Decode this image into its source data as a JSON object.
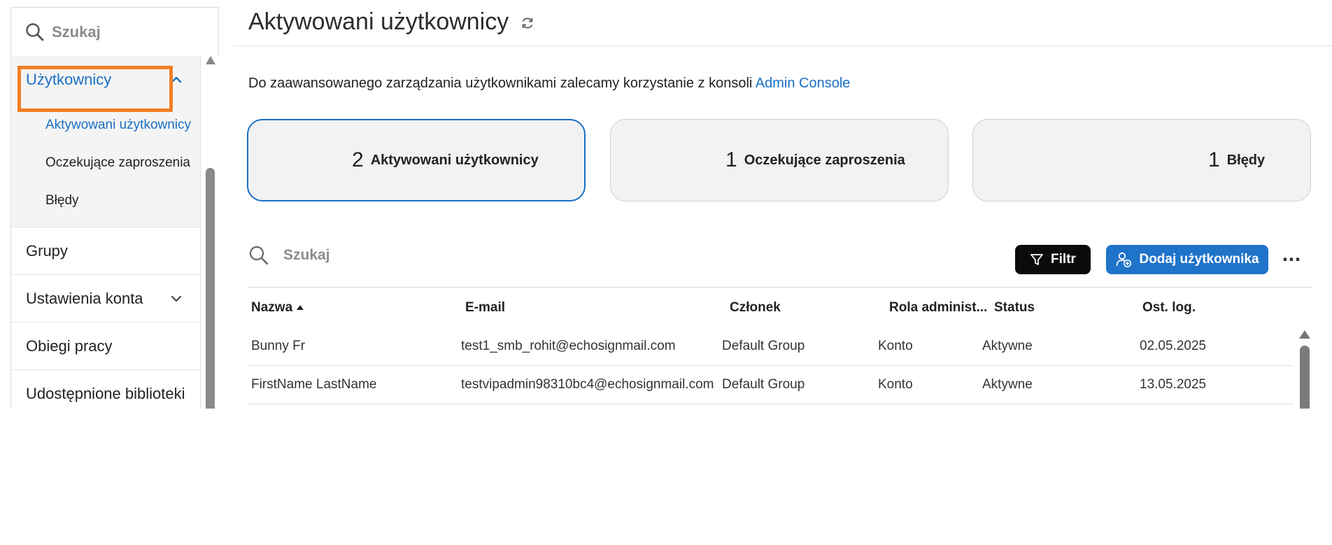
{
  "sidebar": {
    "search_placeholder": "Szukaj",
    "users_label": "Użytkownicy",
    "sub_items": [
      {
        "label": "Aktywowani użytkownicy"
      },
      {
        "label": "Oczekujące zaproszenia"
      },
      {
        "label": "Błędy"
      }
    ],
    "groups_label": "Grupy",
    "account_settings_label": "Ustawienia konta",
    "workflows_label": "Obiegi pracy",
    "shared_libraries_label": "Udostępnione biblioteki"
  },
  "header": {
    "title": "Aktywowani użytkownicy"
  },
  "info": {
    "text": "Do zaawansowanego zarządzania użytkownikami zalecamy korzystanie z konsoli ",
    "link": "Admin Console"
  },
  "stats": [
    {
      "count": "2",
      "label": "Aktywowani użytkownicy"
    },
    {
      "count": "1",
      "label": "Oczekujące zaproszenia"
    },
    {
      "count": "1",
      "label": "Błędy"
    }
  ],
  "toolbar": {
    "search_placeholder": "Szukaj",
    "filter_label": "Filtr",
    "add_user_label": "Dodaj użytkownika",
    "more_label": "···"
  },
  "table": {
    "columns": [
      "Nazwa",
      "E-mail",
      "Członek",
      "Rola administ...",
      "Status",
      "Ost. log."
    ],
    "rows": [
      {
        "name": "Bunny Fr",
        "email": "test1_smb_rohit@echosignmail.com",
        "member": "Default Group",
        "role": "Konto",
        "status": "Aktywne",
        "last_login": "02.05.2025"
      },
      {
        "name": "FirstName LastName",
        "email": "testvipadmin98310bc4@echosignmail.com",
        "member": "Default Group",
        "role": "Konto",
        "status": "Aktywne",
        "last_login": "13.05.2025"
      }
    ]
  },
  "colors": {
    "accent": "#1a6fc4",
    "highlight": "#f07f26",
    "filter_button": "#0b0b0b",
    "add_button": "#1f73c9"
  },
  "icons": {
    "search": "search-icon",
    "refresh": "refresh-icon",
    "chevron_up": "chevron-up-icon",
    "chevron_down": "chevron-down-icon",
    "filter": "filter-icon",
    "add_user": "add-user-icon",
    "sort": "sort-ascending-icon"
  }
}
